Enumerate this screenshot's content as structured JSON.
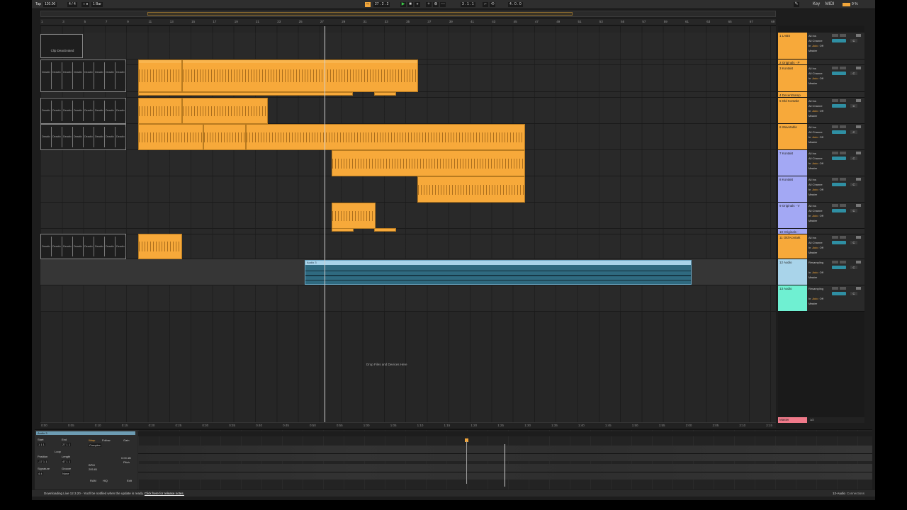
{
  "transport": {
    "tap": "Tap",
    "tempo": "120.00",
    "signature": "4 / 4",
    "metro_label": "○ ●",
    "quantize": "1 Bar",
    "position": "27 .  2 .  2",
    "loop_start": "3 .  1 .  1",
    "loop_length": "4 .  0 .  0",
    "key": "Key",
    "midi": "MIDI",
    "cpu": "9 %"
  },
  "ruler": {
    "bars": [
      "1",
      "3",
      "5",
      "7",
      "9",
      "11",
      "13",
      "15",
      "17",
      "19",
      "21",
      "23",
      "25",
      "27",
      "29",
      "31",
      "33",
      "35",
      "37",
      "39",
      "41",
      "43",
      "45",
      "47",
      "49",
      "51",
      "53",
      "55",
      "57",
      "59",
      "61",
      "63",
      "65",
      "67",
      "69"
    ]
  },
  "time_ruler": [
    "0:00",
    "0:05",
    "0:10",
    "0:15",
    "0:20",
    "0:25",
    "0:30",
    "0:35",
    "0:40",
    "0:45",
    "0:50",
    "0:55",
    "1:00",
    "1:05",
    "1:10",
    "1:15",
    "1:20",
    "1:25",
    "1:30",
    "1:35",
    "1:40",
    "1:45",
    "1:50",
    "1:55",
    "2:00",
    "2:05",
    "2:10",
    "2:15"
  ],
  "arrangement": {
    "clip_deactivated": "Clip Deactivated",
    "deactivated_cell": "Deactiv",
    "audio_clip_name": "Audio 3",
    "drop_hint": "Drop Files and Devices Here"
  },
  "tracks": [
    {
      "name": "1 LABS",
      "color": "#f7a93a",
      "input": "All Ins",
      "channel": "All Channe",
      "monitor": [
        "In",
        "Auto",
        "Off"
      ],
      "output": "Master",
      "pan": "C"
    },
    {
      "name": "2 Originals - P",
      "color": "#f7a93a"
    },
    {
      "name": "3 Kontakt",
      "color": "#f7a93a",
      "input": "All Ins",
      "channel": "All Channe",
      "monitor": [
        "In",
        "Auto",
        "Off"
      ],
      "output": "Master",
      "pan": "C"
    },
    {
      "name": "4 DecentSamp",
      "color": "#f7a93a"
    },
    {
      "name": "5 Old Kontakt",
      "color": "#f7a93a",
      "input": "All Ins",
      "channel": "All Channe",
      "monitor": [
        "In",
        "Auto",
        "Off"
      ],
      "output": "Master",
      "pan": "C"
    },
    {
      "name": "6 Wavetable",
      "color": "#f7a93a",
      "input": "All Ins",
      "channel": "All Channe",
      "monitor": [
        "In",
        "Auto",
        "Off"
      ],
      "output": "Master",
      "pan": "C"
    },
    {
      "name": "7 Kontakt",
      "color": "#a3a8f4",
      "input": "All Ins",
      "channel": "All Channe",
      "monitor": [
        "In",
        "Auto",
        "Off"
      ],
      "output": "Master",
      "pan": "C"
    },
    {
      "name": "8 Kontakt",
      "color": "#a3a8f4",
      "input": "All Ins",
      "channel": "All Channe",
      "monitor": [
        "In",
        "Auto",
        "Off"
      ],
      "output": "Master",
      "pan": "C"
    },
    {
      "name": "9 Originals - V",
      "color": "#a3a8f4",
      "input": "All Ins",
      "channel": "All Channe",
      "monitor": [
        "In",
        "Auto",
        "Off"
      ],
      "output": "Master",
      "pan": "C"
    },
    {
      "name": "10 Originals -",
      "color": "#a3a8f4"
    },
    {
      "name": "11 Old Kontakt",
      "color": "#f7a93a",
      "input": "All Ins",
      "channel": "All Channe",
      "monitor": [
        "In",
        "Auto",
        "Off"
      ],
      "output": "Master",
      "pan": "C"
    },
    {
      "name": "12 Audio",
      "color": "#a9d4ea",
      "input": "Resampling",
      "channel": "",
      "monitor": [
        "In",
        "Auto",
        "Off"
      ],
      "output": "Master",
      "pan": "C"
    },
    {
      "name": "13 Audio",
      "color": "#6ff0d2",
      "input": "Resampling",
      "channel": "",
      "monitor": [
        "In",
        "Auto",
        "Off"
      ],
      "output": "Master",
      "pan": "C"
    }
  ],
  "master": {
    "name": "Master",
    "ctl": "1/2"
  },
  "detail": {
    "clip_title": "Audio 3",
    "start_label": "Start",
    "end_label": "End",
    "start_val": "1  1  1",
    "end_val": "27  1  1",
    "loop_label": "Loop",
    "position_label": "Position",
    "length_label": "Length",
    "position_val": "-17  1  1",
    "length_val": "47  1  1",
    "signature_label": "Signature",
    "groove_label": "Groove",
    "sig_val": "4    4",
    "groove_val": "None",
    "warp_label": "Warp",
    "follow_label": "Follow",
    "mode_val": "Complex",
    "bpm_label": "BPM",
    "bpm_val": "205.81",
    "gain_label": "Gain",
    "gain_val": "0.00 dB",
    "pitch_label": "Pitch",
    "ram_label": "RAM",
    "hiq_label": "HiQ",
    "edit_label": "Edit"
  },
  "status": {
    "text": "Downloading Live 12.3.20 - You'll be notified when the update is ready.",
    "link": "Click here for release notes.",
    "track": "12-Audio",
    "device": "Connections"
  }
}
